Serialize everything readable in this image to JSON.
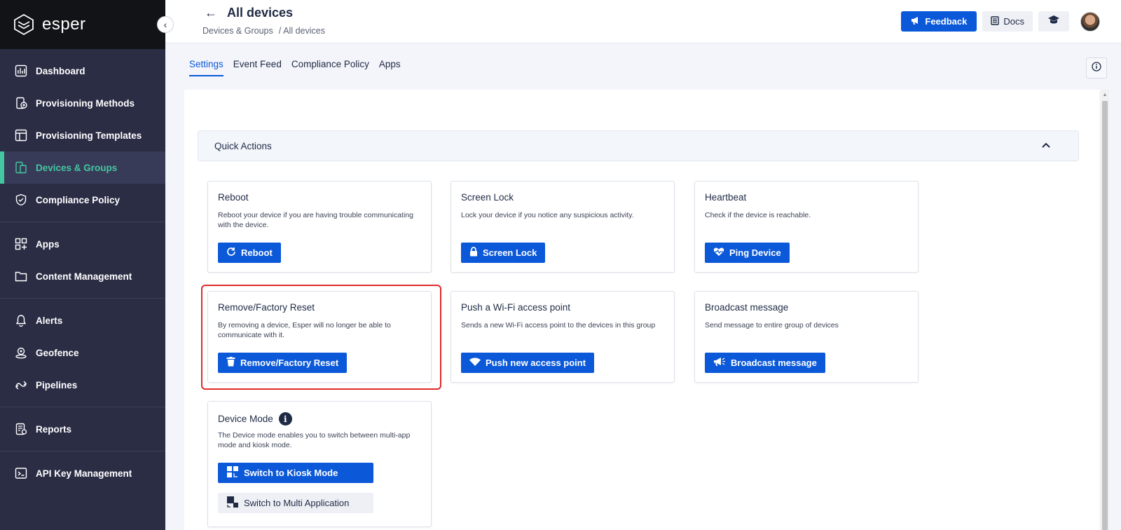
{
  "brand": {
    "name": "esper"
  },
  "sidebar": {
    "groups": [
      [
        {
          "label": "Dashboard",
          "icon": "dashboard-icon"
        },
        {
          "label": "Provisioning Methods",
          "icon": "provisioning-methods-icon"
        },
        {
          "label": "Provisioning Templates",
          "icon": "provisioning-templates-icon"
        },
        {
          "label": "Devices & Groups",
          "icon": "devices-groups-icon",
          "active": true
        },
        {
          "label": "Compliance Policy",
          "icon": "shield-icon"
        }
      ],
      [
        {
          "label": "Apps",
          "icon": "apps-icon"
        },
        {
          "label": "Content Management",
          "icon": "folder-icon"
        }
      ],
      [
        {
          "label": "Alerts",
          "icon": "bell-icon"
        },
        {
          "label": "Geofence",
          "icon": "geofence-icon"
        },
        {
          "label": "Pipelines",
          "icon": "pipelines-icon"
        }
      ],
      [
        {
          "label": "Reports",
          "icon": "reports-icon"
        }
      ],
      [
        {
          "label": "API Key Management",
          "icon": "terminal-icon"
        }
      ]
    ]
  },
  "header": {
    "title": "All devices",
    "breadcrumb": {
      "parent": "Devices & Groups",
      "separator": "/",
      "current": "All devices"
    },
    "feedback_label": "Feedback",
    "docs_label": "Docs"
  },
  "tabs": [
    "Settings",
    "Event Feed",
    "Compliance Policy",
    "Apps"
  ],
  "quick_actions": {
    "label": "Quick Actions"
  },
  "cards": {
    "reboot": {
      "title": "Reboot",
      "desc": "Reboot your device if you are having trouble communicating with the device.",
      "button": "Reboot"
    },
    "screen_lock": {
      "title": "Screen Lock",
      "desc": "Lock your device if you notice any suspicious activity.",
      "button": "Screen Lock"
    },
    "heartbeat": {
      "title": "Heartbeat",
      "desc": "Check if the device is reachable.",
      "button": "Ping Device"
    },
    "remove": {
      "title": "Remove/Factory Reset",
      "desc": "By removing a device, Esper will no longer be able to communicate with it.",
      "button": "Remove/Factory Reset"
    },
    "wifi": {
      "title": "Push a Wi-Fi access point",
      "desc": "Sends a new Wi-Fi access point to the devices in this group",
      "button": "Push new access point"
    },
    "broadcast": {
      "title": "Broadcast message",
      "desc": "Send message to entire group of devices",
      "button": "Broadcast message"
    },
    "device_mode": {
      "title": "Device Mode",
      "desc": "The Device mode enables you to switch between multi-app mode and kiosk mode.",
      "button_kiosk": "Switch to Kiosk Mode",
      "button_multi": "Switch to Multi Application"
    }
  },
  "colors": {
    "primary": "#0b59d9",
    "sidebar": "#2b2d45",
    "accent": "#43c7a0",
    "highlight": "#e02a2a"
  }
}
